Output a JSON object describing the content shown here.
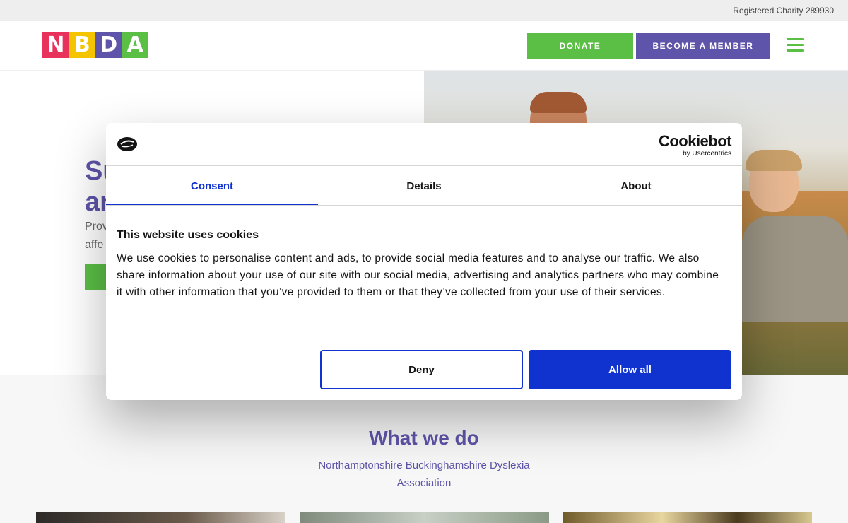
{
  "topbar": {
    "charity_text": "Registered Charity 289930"
  },
  "header": {
    "logo_letters": [
      "N",
      "B",
      "D",
      "A"
    ],
    "logo_colors": [
      "#e8315b",
      "#f5c400",
      "#5e54a9",
      "#5bbf46"
    ],
    "donate_label": "DONATE",
    "member_label": "BECOME A MEMBER",
    "menu_icon": "hamburger-menu-icon"
  },
  "hero": {
    "title_line1": "Su",
    "title_line2": "ar",
    "text_line1": "Prov",
    "text_line2": "affe"
  },
  "what_we_do": {
    "title": "What we do",
    "subtitle": "Northamptonshire Buckinghamshire Dyslexia Association"
  },
  "cookie_banner": {
    "brand_name": "Cookiebot",
    "brand_sub": "by Usercentrics",
    "tabs": [
      {
        "label": "Consent",
        "active": true
      },
      {
        "label": "Details",
        "active": false
      },
      {
        "label": "About",
        "active": false
      }
    ],
    "heading": "This website uses cookies",
    "body": "We use cookies to personalise content and ads, to provide social media features and to analyse our traffic. We also share information about your use of our site with our social media, advertising and analytics partners who may combine it with other information that you’ve provided to them or that they’ve collected from your use of their services.",
    "deny_label": "Deny",
    "allow_label": "Allow all",
    "colors": {
      "accent": "#1032cf"
    }
  },
  "colors": {
    "brand_purple": "#5e54a9",
    "brand_green": "#5bbf46"
  }
}
